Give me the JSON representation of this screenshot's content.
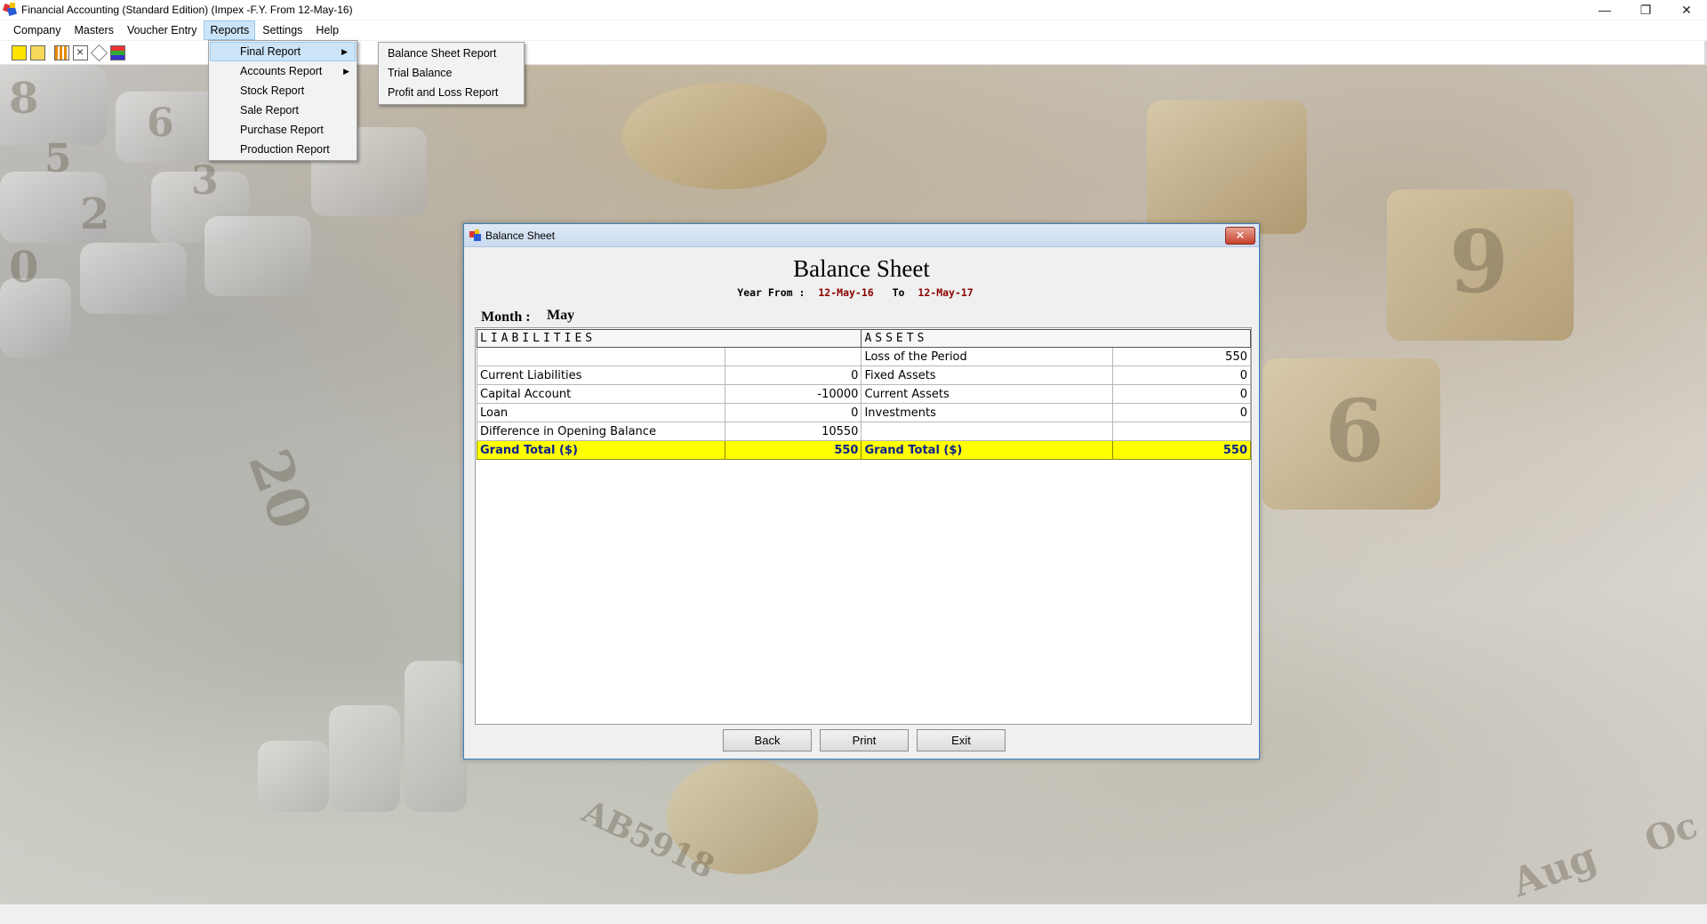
{
  "app": {
    "title": "Financial Accounting (Standard Edition) (Impex -F.Y. From 12-May-16)"
  },
  "window_controls": {
    "minimize": "—",
    "restore": "❐",
    "close": "✕"
  },
  "menubar": [
    "Company",
    "Masters",
    "Voucher Entry",
    "Reports",
    "Settings",
    "Help"
  ],
  "reports_menu": {
    "items": [
      "Final Report",
      "Accounts Report",
      "Stock Report",
      "Sale Report",
      "Purchase Report",
      "Production Report"
    ],
    "submenu_arrow": "▶"
  },
  "final_report_submenu": [
    "Balance Sheet Report",
    "Trial Balance",
    "Profit and Loss Report"
  ],
  "toolbar_icons": [
    "new-icon",
    "open-icon",
    "report-icon",
    "calculator-icon",
    "settings-icon",
    "color-icon"
  ],
  "dialog": {
    "title": "Balance Sheet",
    "close": "✕",
    "report_title": "Balance Sheet",
    "year_from_label": "Year From  :",
    "year_from": "12-May-16",
    "to_label": "To",
    "year_to": "12-May-17",
    "month_label": "Month :",
    "month": "May",
    "headers": {
      "liabilities": "LIABILITIES",
      "assets": "ASSETS"
    },
    "rows": [
      {
        "l_name": "",
        "l_amt": "",
        "a_name": "Loss of the Period",
        "a_amt": "550"
      },
      {
        "l_name": "Current Liabilities",
        "l_amt": "0",
        "a_name": "Fixed Assets",
        "a_amt": "0"
      },
      {
        "l_name": "Capital Account",
        "l_amt": "-10000",
        "a_name": "Current Assets",
        "a_amt": "0"
      },
      {
        "l_name": "Loan",
        "l_amt": "0",
        "a_name": "Investments",
        "a_amt": "0"
      },
      {
        "l_name": "Difference in Opening Balance",
        "l_amt": "10550",
        "a_name": "",
        "a_amt": ""
      }
    ],
    "total": {
      "l_name": "Grand Total ($)",
      "l_amt": "550",
      "a_name": "Grand Total ($)",
      "a_amt": "550"
    },
    "buttons": {
      "back": "Back",
      "print": "Print",
      "exit": "Exit"
    }
  },
  "colors": {
    "total_row": "#ffff00",
    "total_text": "#0a1f8f",
    "date_text": "#8b0000",
    "menu_highlight": "#cce4f7"
  },
  "background_text": [
    "8",
    "6",
    "5",
    "3",
    "2",
    "0",
    "9",
    "6",
    "20",
    "Aug",
    "Oc",
    "AB5918"
  ]
}
